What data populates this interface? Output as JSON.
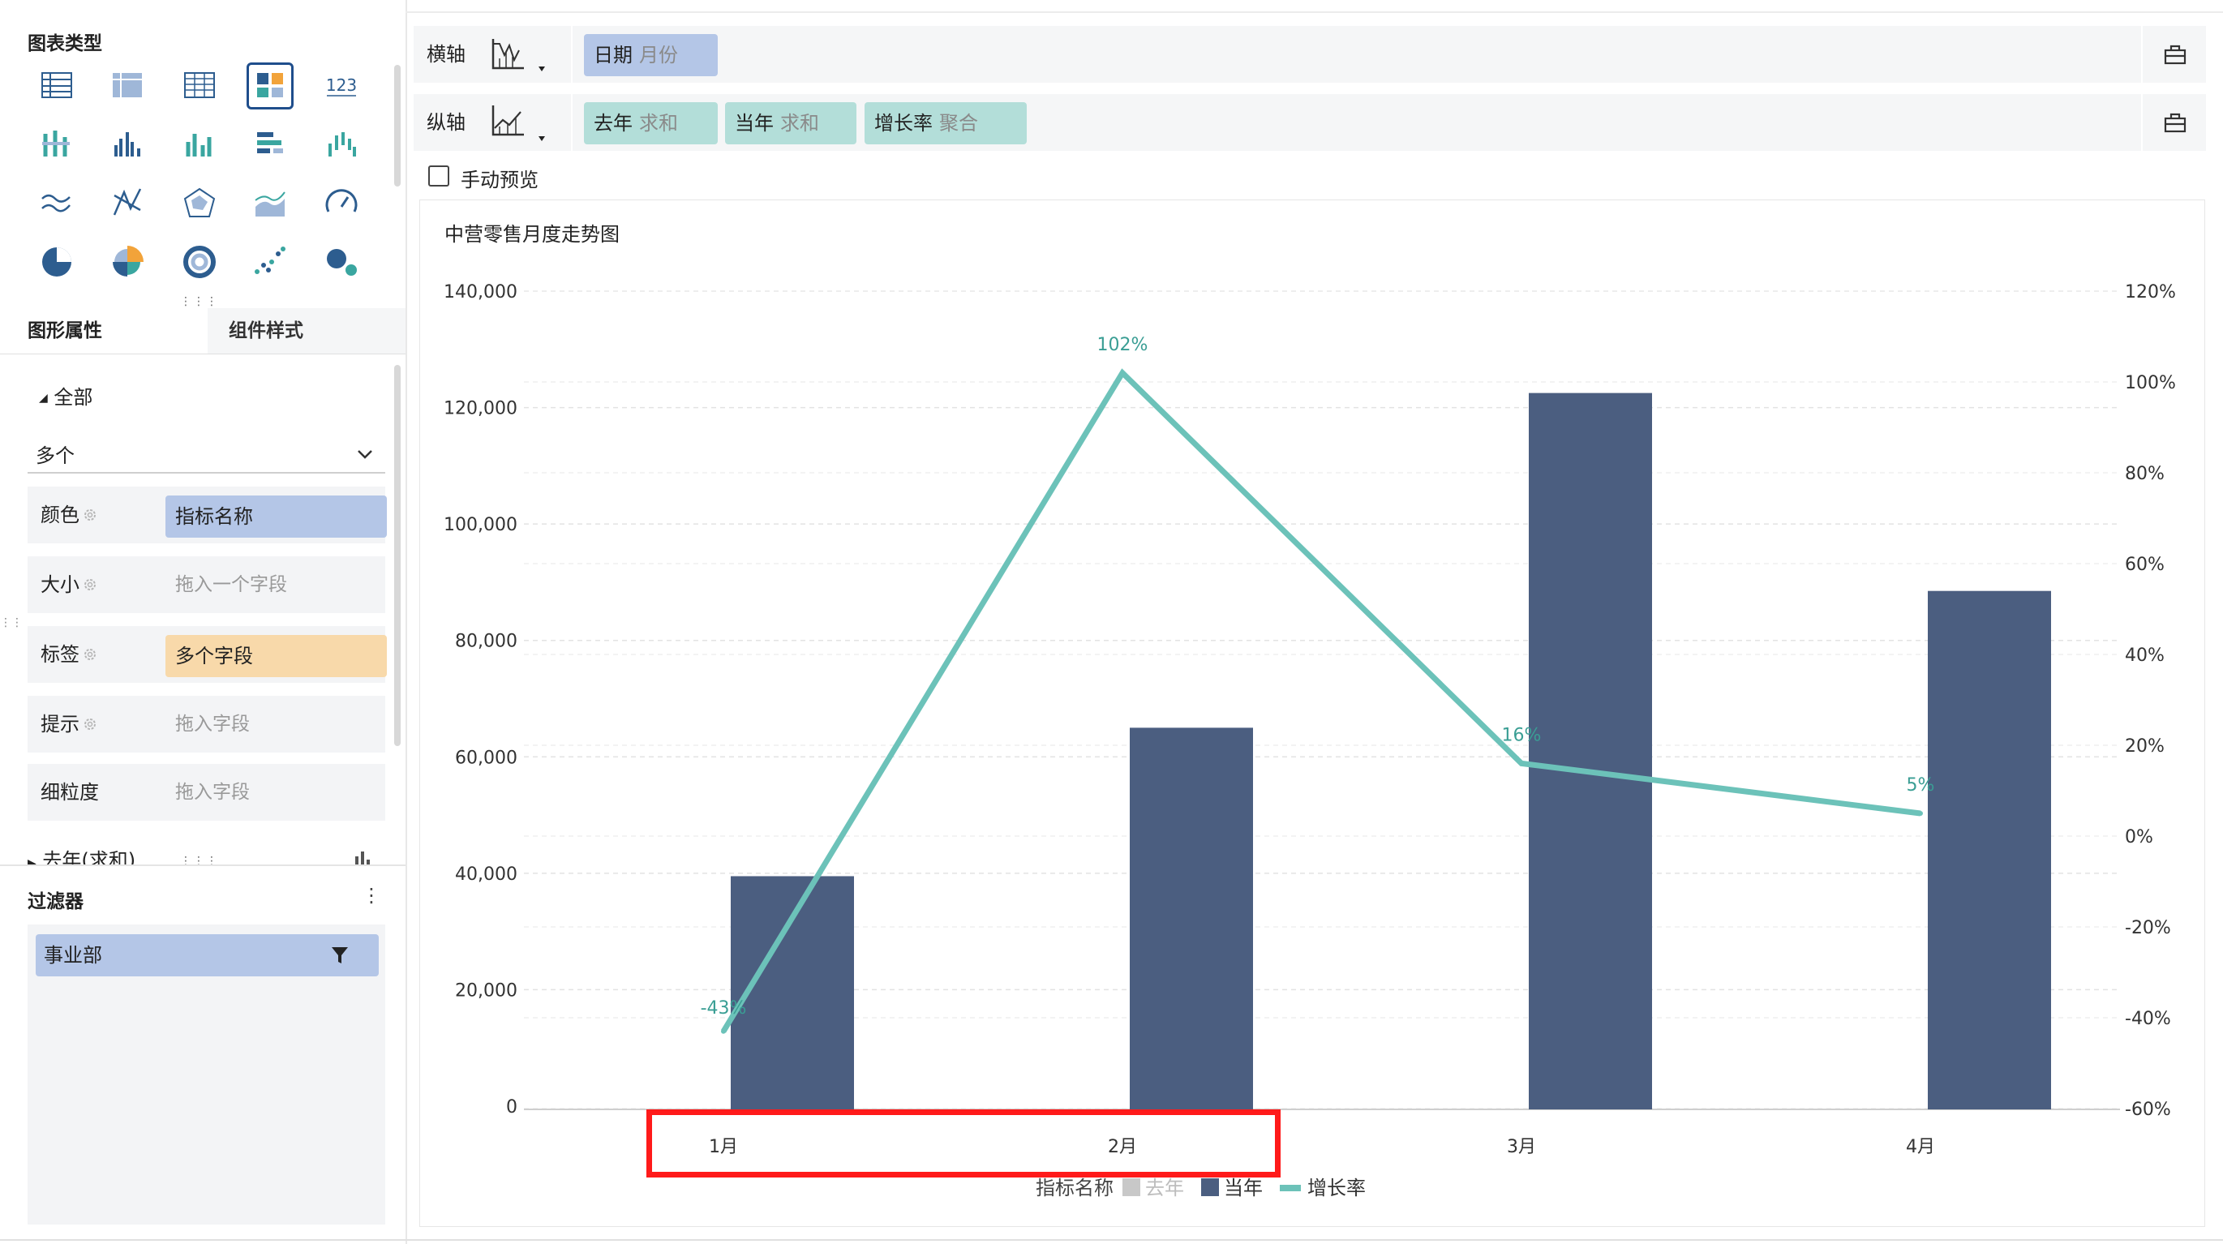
{
  "left_panel": {
    "chart_types_title": "图表类型",
    "chart_type_icons": [
      "table-icon",
      "cross-table-icon",
      "detail-table-icon",
      "dashboard-table-icon",
      "kpi-number-icon",
      "grouped-bar-icon",
      "column-chart-icon",
      "multi-column-icon",
      "stacked-bar-icon",
      "waterfall-icon",
      "line-chart-icon",
      "radar-icon",
      "polar-chart-icon",
      "area-chart-icon",
      "gauge-icon",
      "pie-chart-icon",
      "rose-chart-icon",
      "donut-chart-icon",
      "scatter-icon",
      "bubble-chart-icon"
    ],
    "kpi_label": "123",
    "tabs": {
      "graph_props": "图形属性",
      "component_style": "组件样式"
    },
    "all_label": "全部",
    "select_value": "多个",
    "props": [
      {
        "label": "颜色",
        "value": "指标名称",
        "kind": "field"
      },
      {
        "label": "大小",
        "value": "拖入一个字段",
        "kind": "placeholder"
      },
      {
        "label": "标签",
        "value": "多个字段",
        "kind": "tag"
      },
      {
        "label": "提示",
        "value": "拖入字段",
        "kind": "placeholder"
      },
      {
        "label": "细粒度",
        "value": "拖入字段",
        "kind": "placeholder"
      }
    ],
    "collapsed_item": "去年(求和)",
    "filter_title": "过滤器",
    "filter_item": "事业部"
  },
  "shelves": {
    "x_axis_label": "横轴",
    "y_axis_label": "纵轴",
    "x_fields": [
      {
        "name": "日期",
        "agg": "月份"
      }
    ],
    "y_fields": [
      {
        "name": "去年",
        "agg": "求和"
      },
      {
        "name": "当年",
        "agg": "求和"
      },
      {
        "name": "增长率",
        "agg": "聚合"
      }
    ],
    "manual_preview": "手动预览"
  },
  "colors": {
    "bar": "#4b5e80",
    "line": "#6cc2b9",
    "line_label": "#3a9e94",
    "field_chip": "#b4c6e7",
    "measure_chip": "#b3ded9",
    "tag_chip": "#f8d9aa",
    "highlight": "#ff1a1a",
    "legend_last_year": "#c8c8c8"
  },
  "chart_data": {
    "type": "bar",
    "title": "中营零售月度走势图",
    "categories": [
      "1月",
      "2月",
      "3月",
      "4月"
    ],
    "series": [
      {
        "name": "当年",
        "type": "bar",
        "axis": "left",
        "values": [
          39500,
          65000,
          122500,
          88500
        ]
      },
      {
        "name": "增长率",
        "type": "line",
        "axis": "right",
        "values": [
          -43,
          102,
          16,
          5
        ]
      }
    ],
    "point_labels": [
      "-43%",
      "102%",
      "16%",
      "5%"
    ],
    "left_axis": {
      "ylim": [
        0,
        140000
      ],
      "ticks": [
        "0",
        "20,000",
        "40,000",
        "60,000",
        "80,000",
        "100,000",
        "120,000",
        "140,000"
      ]
    },
    "right_axis": {
      "ylim": [
        -60,
        120
      ],
      "ticks": [
        "-60%",
        "-40%",
        "-20%",
        "0%",
        "20%",
        "40%",
        "60%",
        "80%",
        "100%",
        "120%"
      ]
    },
    "legend_title": "指标名称",
    "legend": [
      "去年",
      "当年",
      "增长率"
    ],
    "legend_inactive": [
      "去年"
    ],
    "grid": true,
    "legend_position": "bottom"
  }
}
